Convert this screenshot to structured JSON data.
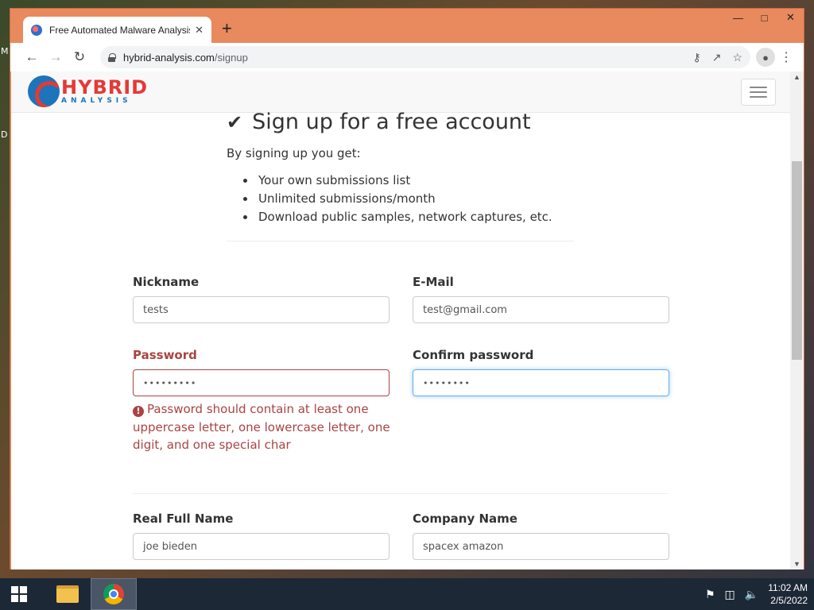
{
  "desktop": {
    "edge_text_1": "M",
    "edge_text_2": "D"
  },
  "browser": {
    "tab_title": "Free Automated Malware Analysis",
    "url_host": "hybrid-analysis.com",
    "url_path": "/signup"
  },
  "site": {
    "logo_word": "HYBRID",
    "logo_sub": "ANALYSIS"
  },
  "signup": {
    "heading": "Sign up for a free account",
    "intro": "By signing up you get:",
    "benefits": [
      "Your own submissions list",
      "Unlimited submissions/month",
      "Download public samples, network captures, etc."
    ]
  },
  "form": {
    "nickname": {
      "label": "Nickname",
      "value": "tests"
    },
    "email": {
      "label": "E-Mail",
      "value": "test@gmail.com"
    },
    "password": {
      "label": "Password",
      "value": "•••••••••"
    },
    "confirm_password": {
      "label": "Confirm password",
      "value": "••••••••"
    },
    "password_error": "Password should contain at least one uppercase letter, one lowercase letter, one digit, and one special char",
    "real_name": {
      "label": "Real Full Name",
      "value": "joe bieden"
    },
    "company": {
      "label": "Company Name",
      "value": "spacex amazon"
    }
  },
  "taskbar": {
    "time": "11:02 AM",
    "date": "2/5/2022"
  },
  "colors": {
    "window_frame": "#e8895e",
    "error": "#a94442",
    "focus_border": "#66afe9",
    "logo_red": "#e53935",
    "logo_blue": "#1c74bb"
  }
}
